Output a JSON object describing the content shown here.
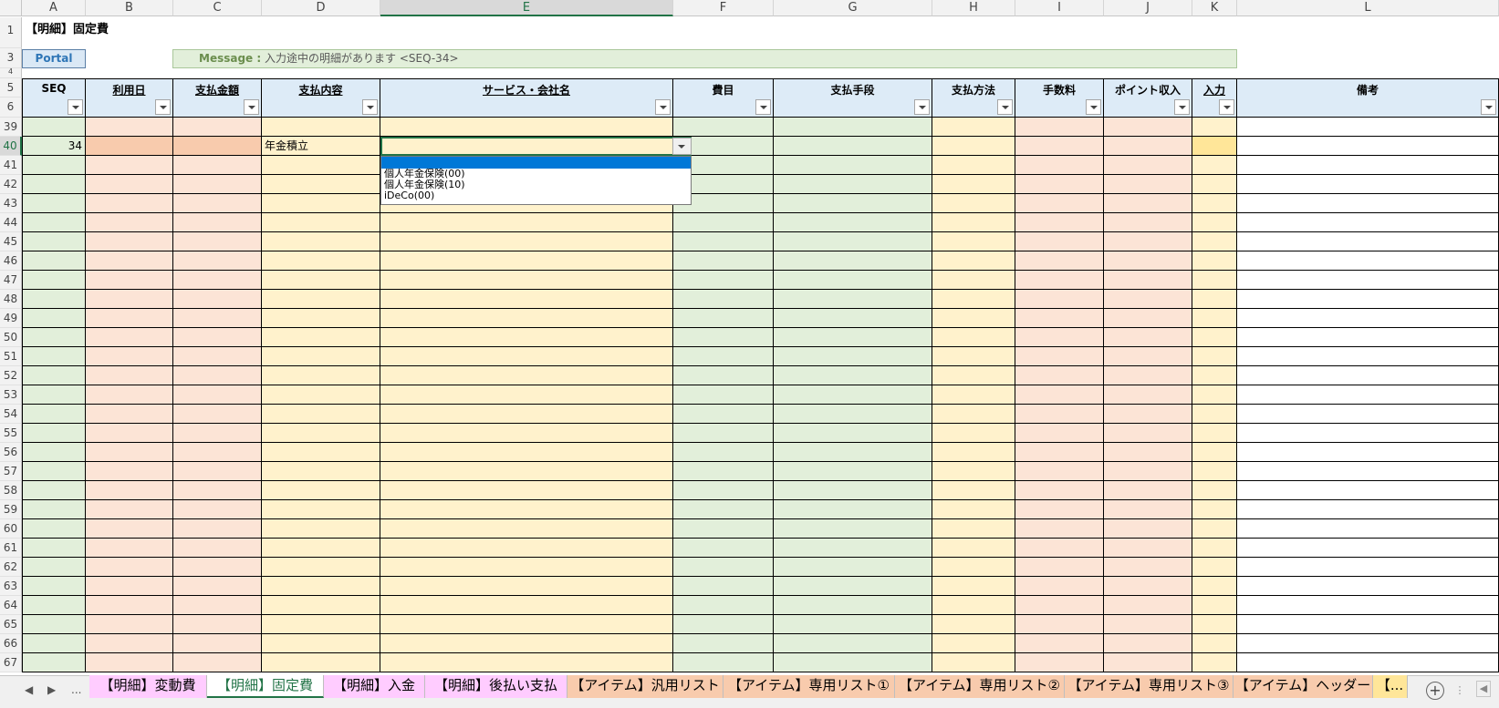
{
  "columns": [
    "A",
    "B",
    "C",
    "D",
    "E",
    "F",
    "G",
    "H",
    "I",
    "J",
    "K",
    "L"
  ],
  "selected_column": "E",
  "row_numbers": [
    "1",
    "3",
    "4",
    "5",
    "6",
    "39",
    "40",
    "41",
    "42",
    "43",
    "44",
    "45",
    "46",
    "47",
    "48",
    "49",
    "50",
    "51",
    "52",
    "53",
    "54",
    "55",
    "56",
    "57",
    "58",
    "59",
    "60",
    "61",
    "62",
    "63",
    "64",
    "65",
    "66",
    "67"
  ],
  "selected_row": "40",
  "sheet_title": "【明細】固定費",
  "portal_button": "Portal",
  "message": {
    "label": "Message :",
    "text": "入力途中の明細があります <SEQ-34>"
  },
  "headers": [
    "SEQ",
    "利用日",
    "支払金額",
    "支払内容",
    "サービス・会社名",
    "費目",
    "支払手段",
    "支払方法",
    "手数料",
    "ポイント収入",
    "入力",
    "備考"
  ],
  "underlined_headers": [
    "利用日",
    "支払金額",
    "支払内容",
    "サービス・会社名",
    "入力"
  ],
  "colors": {
    "seq": "#e2efda",
    "date": "#fce4d6",
    "amount": "#fce4d6",
    "content": "#fff2cc",
    "service": "#fff2cc",
    "item": "#e2efda",
    "means": "#e2efda",
    "method": "#fff2cc",
    "fee": "#fce4d6",
    "points": "#fce4d6",
    "input": "#fff2cc",
    "note": "#ffffff",
    "active_row_accent": "#f8cbad",
    "input_active": "#ffe699"
  },
  "active_row": {
    "seq": "34",
    "content": "年金積立"
  },
  "dropdown_options": [
    "",
    "個人年金保険(00)",
    "個人年金保険(10)",
    "iDeCo(00)"
  ],
  "sheet_tabs": [
    {
      "label": "【明細】変動費",
      "color": "#ffccff"
    },
    {
      "label": "【明細】固定費",
      "color": "#ffffff",
      "active": true
    },
    {
      "label": "【明細】入金",
      "color": "#ffccff"
    },
    {
      "label": "【明細】後払い支払",
      "color": "#ffccff"
    },
    {
      "label": "【アイテム】汎用リスト",
      "color": "#f8cbad"
    },
    {
      "label": "【アイテム】専用リスト①",
      "color": "#f8cbad"
    },
    {
      "label": "【アイテム】専用リスト②",
      "color": "#f8cbad"
    },
    {
      "label": "【アイテム】専用リスト③",
      "color": "#f8cbad"
    },
    {
      "label": "【アイテム】ヘッダー",
      "color": "#f8cbad"
    },
    {
      "label": "【...",
      "color": "#ffe699"
    }
  ],
  "tab_nav": {
    "prev": "◀",
    "next": "▶",
    "more": "...",
    "add": "+",
    "menu": "⋮"
  }
}
